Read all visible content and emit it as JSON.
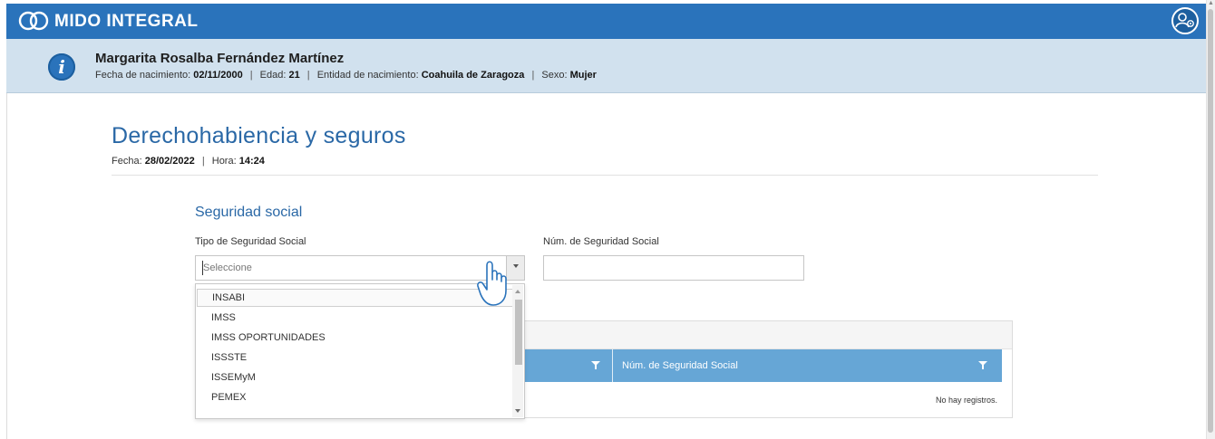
{
  "app": {
    "title": "MIDO INTEGRAL"
  },
  "icons": {
    "logo": "linked-rings-icon",
    "user": "user-settings-icon",
    "info": "info-icon",
    "caret": "chevron-down-icon",
    "filter": "filter-icon",
    "cursor": "hand-pointer-cursor"
  },
  "colors": {
    "brand_blue": "#2a73bb",
    "band_bg": "#d1e1ee",
    "grid_header": "#66a6d6",
    "heading": "#2a68a6"
  },
  "patient": {
    "name": "Margarita Rosalba Fernández Martínez",
    "dob_label": "Fecha de nacimiento:",
    "dob_value": "02/11/2000",
    "age_label": "Edad:",
    "age_value": "21",
    "state_label": "Entidad de nacimiento:",
    "state_value": "Coahuila de Zaragoza",
    "sex_label": "Sexo:",
    "sex_value": "Mujer",
    "separator": "|"
  },
  "page": {
    "title": "Derechohabiencia y seguros",
    "date_label": "Fecha:",
    "date_value": "28/02/2022",
    "time_label": "Hora:",
    "time_value": "14:24",
    "separator": "|"
  },
  "section": {
    "title": "Seguridad social",
    "type_label": "Tipo de Seguridad Social",
    "type_placeholder": "Seleccione",
    "number_label": "Núm. de Seguridad Social",
    "number_value": ""
  },
  "dropdown": {
    "options": [
      "INSABI",
      "IMSS",
      "IMSS OPORTUNIDADES",
      "ISSSTE",
      "ISSEMyM",
      "PEMEX"
    ],
    "highlighted": "INSABI"
  },
  "grid": {
    "columns": [
      "",
      "Núm. de Seguridad Social"
    ],
    "empty_message": "No hay registros."
  }
}
